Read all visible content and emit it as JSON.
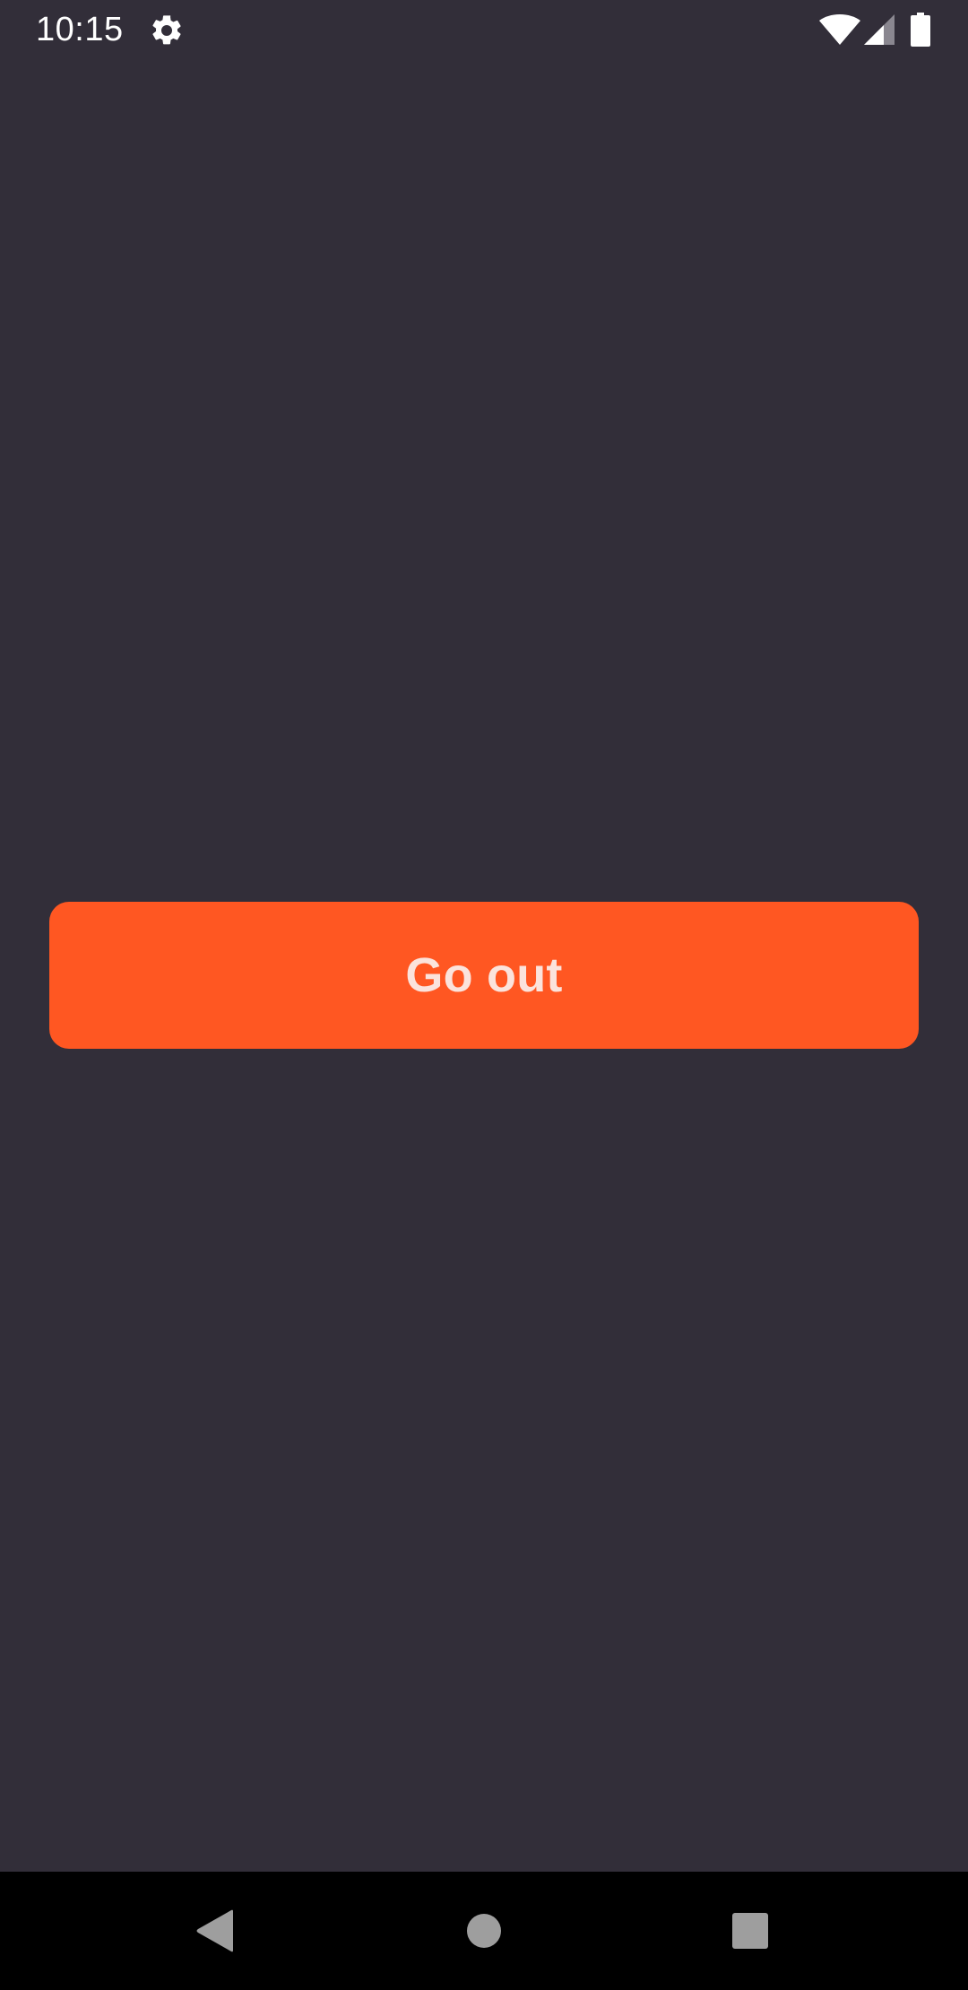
{
  "status_bar": {
    "time": "10:15",
    "icons": [
      "settings-icon",
      "wifi-icon",
      "cell-signal-icon",
      "battery-icon"
    ]
  },
  "main": {
    "button": {
      "label": "Go out",
      "color": "#ff5722"
    },
    "background_color": "#322e39"
  },
  "nav_bar": {
    "buttons": [
      "back",
      "home",
      "recents"
    ],
    "icon_color": "#9e9e9e"
  }
}
